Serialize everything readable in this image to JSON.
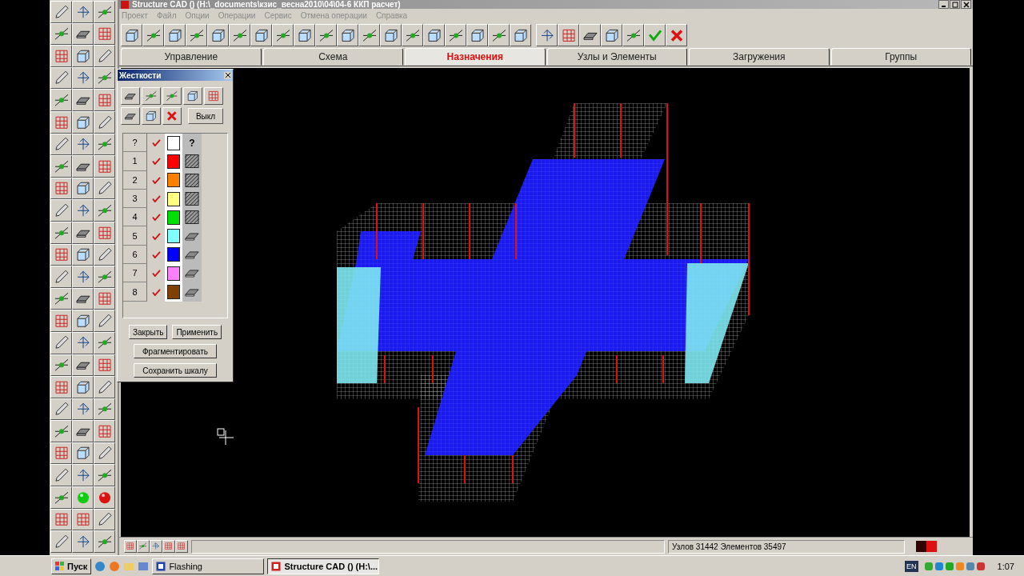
{
  "window": {
    "title": "Structure CAD () (H:\\_documents\\кзис_весна2010\\04\\04-6 ККП расчет)"
  },
  "menu": [
    "Проект",
    "Файл",
    "Опции",
    "Операции",
    "Сервис",
    "Отмена операции",
    "Справка"
  ],
  "tabs": [
    {
      "label": "Управление",
      "selected": false
    },
    {
      "label": "Схема",
      "selected": false
    },
    {
      "label": "Назначения",
      "selected": true
    },
    {
      "label": "Узлы и Элементы",
      "selected": false
    },
    {
      "label": "Загружения",
      "selected": false
    },
    {
      "label": "Группы",
      "selected": false
    }
  ],
  "stiffness_dialog": {
    "title": "Жесткости",
    "off_button": "Выкл",
    "rows": [
      {
        "label": "?",
        "checked": true,
        "color": "#ffffff",
        "pattern": {
          "kind": "text",
          "text": "?"
        }
      },
      {
        "label": "1",
        "checked": true,
        "color": "#ff0000",
        "pattern": {
          "kind": "hatch"
        }
      },
      {
        "label": "2",
        "checked": true,
        "color": "#ff8000",
        "pattern": {
          "kind": "hatch"
        }
      },
      {
        "label": "3",
        "checked": true,
        "color": "#ffff80",
        "pattern": {
          "kind": "hatch"
        }
      },
      {
        "label": "4",
        "checked": true,
        "color": "#00e000",
        "pattern": {
          "kind": "hatch"
        }
      },
      {
        "label": "5",
        "checked": true,
        "color": "#80ffff",
        "pattern": {
          "kind": "plate"
        }
      },
      {
        "label": "6",
        "checked": true,
        "color": "#0000ff",
        "pattern": {
          "kind": "plate"
        }
      },
      {
        "label": "7",
        "checked": true,
        "color": "#ff80ff",
        "pattern": {
          "kind": "plate"
        }
      },
      {
        "label": "8",
        "checked": true,
        "color": "#804000",
        "pattern": {
          "kind": "plate"
        }
      }
    ],
    "buttons": [
      "Закрыть",
      "Применить",
      "Фрагментировать",
      "Сохранить шкалу"
    ]
  },
  "status_bar": {
    "counts": "Узлов 31442 Элементов 35497"
  },
  "taskbar": {
    "start": "Пуск",
    "tasks": [
      {
        "label": "Flashing",
        "selected": false
      },
      {
        "label": "Structure CAD () (H:\\...",
        "selected": true
      }
    ],
    "language": "EN",
    "clock": "1:07"
  }
}
